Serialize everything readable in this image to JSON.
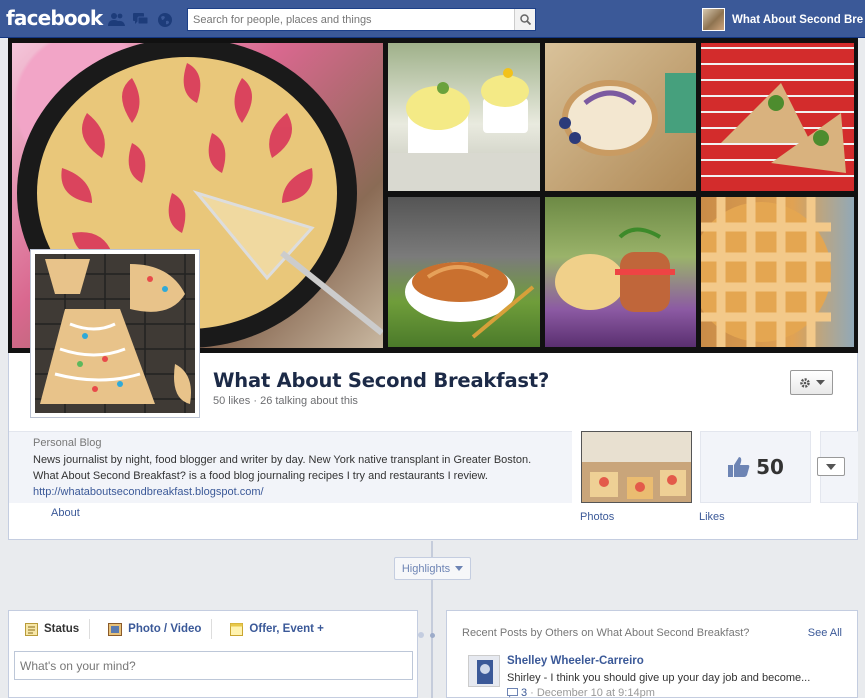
{
  "topbar": {
    "logo": "facebook",
    "search_placeholder": "Search for people, places and things",
    "user_name": "What About Second Bre",
    "icons": [
      "friends-icon",
      "messages-icon",
      "notifications-globe-icon",
      "search-icon"
    ]
  },
  "cover": {
    "tiles": [
      "plum-clafoutis-skillet",
      "lemon-sorbet-cups",
      "blueberry-cake-roll",
      "tart-slices-on-red-napkin",
      "pad-thai-bowl",
      "biscuit-sandwich",
      "peach-lattice-pie"
    ]
  },
  "page": {
    "title": "What About Second Breakfast?",
    "stats": "50 likes · 26 talking about this",
    "gear_icon": "gear-icon"
  },
  "about": {
    "category": "Personal Blog",
    "description": "News journalist by night, food blogger and writer by day. New York native transplant in Greater Boston. What About Second Breakfast? is a food blog journaling recipes I try and restaurants I review.",
    "link": "http://whataboutsecondbreakfast.blogspot.com/",
    "tab_label": "About"
  },
  "apps": {
    "photos_label": "Photos",
    "likes_count": "50",
    "likes_label": "Likes"
  },
  "timeline": {
    "highlights_label": "Highlights"
  },
  "composer": {
    "tabs": [
      {
        "label": "Status",
        "icon": "status-icon"
      },
      {
        "label": "Photo / Video",
        "icon": "camera-icon"
      },
      {
        "label": "Offer, Event +",
        "icon": "offer-event-icon"
      }
    ],
    "placeholder": "What's on your mind?"
  },
  "recent_posts": {
    "heading": "Recent Posts by Others on What About Second Breakfast?",
    "see_all": "See All",
    "post": {
      "author": "Shelley Wheeler-Carreiro",
      "text": "Shirley - I think you should give up your day job and become...",
      "comment_count": "3",
      "timestamp": "· December 10 at 9:14pm"
    }
  },
  "colors": {
    "fb_blue": "#3b5998",
    "fb_dark_blue": "#1c2a47",
    "background": "#e9ebee"
  }
}
